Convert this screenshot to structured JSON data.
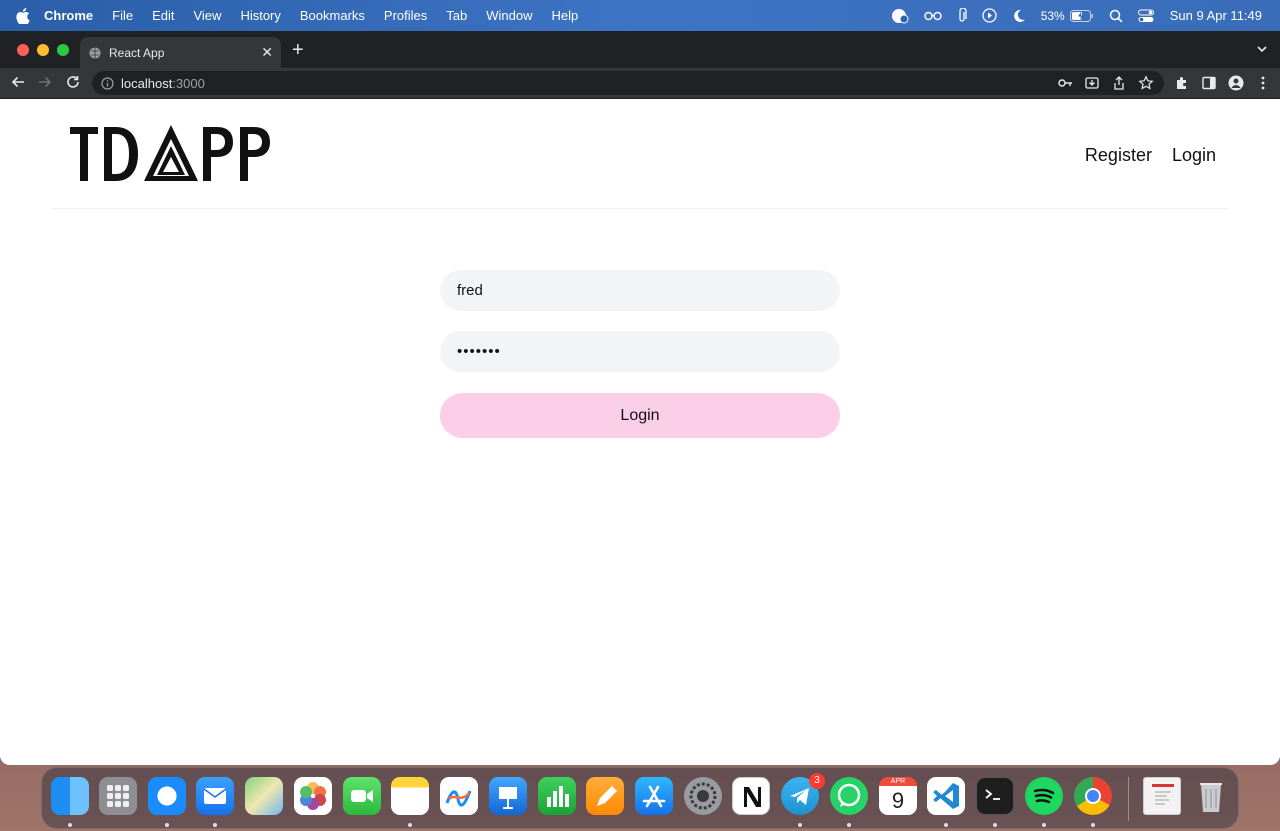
{
  "menubar": {
    "app_name": "Chrome",
    "items": [
      "File",
      "Edit",
      "View",
      "History",
      "Bookmarks",
      "Profiles",
      "Tab",
      "Window",
      "Help"
    ],
    "battery": "53%",
    "datetime": "Sun 9 Apr  11:49"
  },
  "browser": {
    "tab_title": "React App",
    "url_host": "localhost",
    "url_port": ":3000"
  },
  "app": {
    "logo_text": "TD△PP",
    "nav": {
      "register": "Register",
      "login": "Login"
    }
  },
  "login_form": {
    "username_value": "fred",
    "password_value": "•••••••",
    "submit_label": "Login"
  },
  "dock": {
    "apps": [
      "Finder",
      "Launchpad",
      "Safari",
      "Mail",
      "Maps",
      "Photos",
      "FaceTime",
      "Notes",
      "Freeform",
      "Keynote",
      "Numbers",
      "Pages",
      "App Store",
      "System Settings",
      "Notion",
      "Telegram",
      "WhatsApp",
      "Calendar",
      "Visual Studio Code",
      "Terminal",
      "Spotify",
      "Google Chrome",
      "Preview",
      "Trash"
    ],
    "telegram_badge": "3",
    "calendar_month": "APR",
    "calendar_day": "9"
  }
}
